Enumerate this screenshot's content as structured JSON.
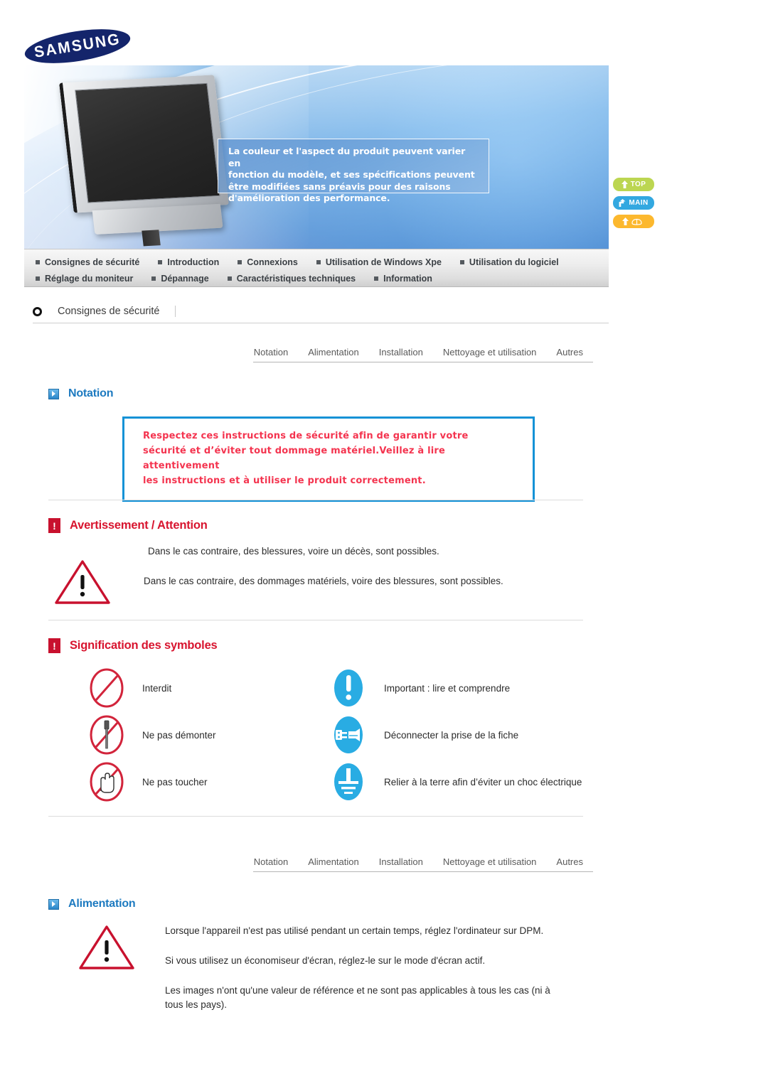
{
  "brand": {
    "logo_text": "SAMSUNG"
  },
  "banner": {
    "callout_lines": [
      "La couleur et l'aspect du produit peuvent varier en",
      "fonction du modèle, et ses spécifications peuvent",
      "être modifiées sans préavis pour des raisons",
      "d'amélioration des performance."
    ]
  },
  "side_buttons": [
    {
      "label": "TOP",
      "icon": "arrow-up-icon",
      "color": "#bcd651"
    },
    {
      "label": "MAIN",
      "icon": "arrow-step-icon",
      "color": "#33a8e0"
    },
    {
      "label": "",
      "icon": "book-icon",
      "color": "#fcb82e"
    }
  ],
  "nav": {
    "row1": [
      "Consignes de sécurité",
      "Introduction",
      "Connexions",
      "Utilisation de Windows Xpe",
      "Utilisation du logiciel"
    ],
    "row2": [
      "Réglage du moniteur",
      "Dépannage",
      "Caractéristiques techniques",
      "Information"
    ]
  },
  "page": {
    "title": "Consignes de sécurité"
  },
  "tabs": [
    "Notation",
    "Alimentation",
    "Installation",
    "Nettoyage et utilisation",
    "Autres"
  ],
  "sections": {
    "notation": {
      "heading": "Notation",
      "notice_lines": [
        "Respectez ces instructions de sécurité afin de garantir votre",
        "sécurité et d’éviter tout dommage matériel.Veillez à lire attentivement",
        "les instructions et à utiliser le produit correctement."
      ]
    },
    "avertissement": {
      "heading": "Avertissement / Attention",
      "line1": "Dans le cas contraire, des blessures, voire un décès, sont possibles.",
      "line2": "Dans le cas contraire, des dommages matériels, voire des blessures, sont possibles."
    },
    "symboles": {
      "heading": "Signification des symboles",
      "items": [
        {
          "icon": "prohibited-icon",
          "label": "Interdit"
        },
        {
          "icon": "important-icon",
          "label": "Important : lire et comprendre"
        },
        {
          "icon": "no-disassemble-icon",
          "label": "Ne pas démonter"
        },
        {
          "icon": "unplug-icon",
          "label": "Déconnecter la prise de la fiche"
        },
        {
          "icon": "do-not-touch-icon",
          "label": "Ne pas toucher"
        },
        {
          "icon": "ground-earth-icon",
          "label": "Relier à la terre afin d’éviter un choc électrique"
        }
      ]
    },
    "alimentation": {
      "heading": "Alimentation",
      "para1": "Lorsque l'appareil n'est pas utilisé pendant un certain temps, réglez l'ordinateur sur DPM.",
      "para2": "Si vous utilisez un économiseur d'écran, réglez-le sur le mode d'écran actif.",
      "para3": "Les images n'ont qu'une valeur de référence et ne sont pas applicables à tous les cas (ni à tous les pays)."
    }
  },
  "colors": {
    "accent_blue": "#1d7ac0",
    "accent_red": "#d8152f",
    "notice_border": "#1492d6",
    "notice_text": "#f4344f",
    "samsung_navy": "#14256b"
  }
}
